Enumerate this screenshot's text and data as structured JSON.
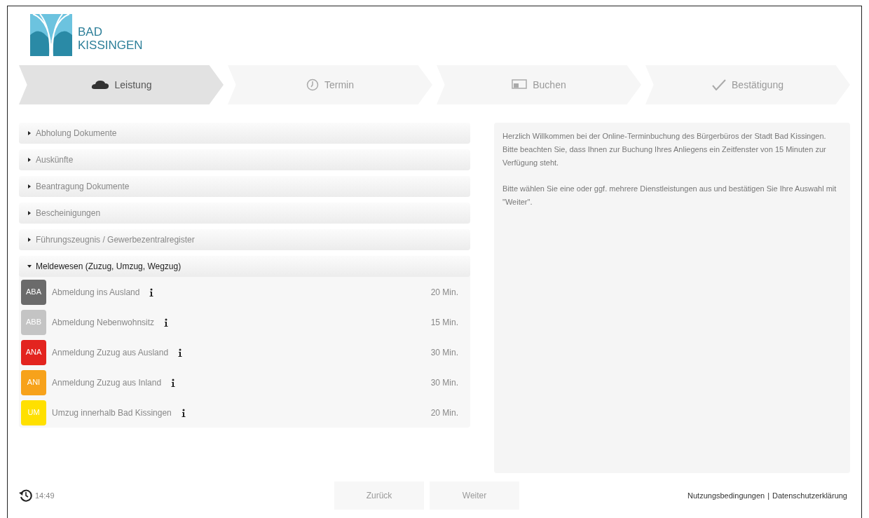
{
  "logo": {
    "line1": "BAD",
    "line2": "KISSINGEN"
  },
  "steps": [
    {
      "label": "Leistung",
      "selected": true
    },
    {
      "label": "Termin",
      "selected": false
    },
    {
      "label": "Buchen",
      "selected": false
    },
    {
      "label": "Bestätigung",
      "selected": false
    }
  ],
  "categories": [
    {
      "label": "Abholung Dokumente",
      "expanded": false
    },
    {
      "label": "Auskünfte",
      "expanded": false
    },
    {
      "label": "Beantragung Dokumente",
      "expanded": false
    },
    {
      "label": "Bescheinigungen",
      "expanded": false
    },
    {
      "label": "Führungszeugnis / Gewerbezentralregister",
      "expanded": false
    },
    {
      "label": "Meldewesen (Zuzug, Umzug, Wegzug)",
      "expanded": true,
      "services": [
        {
          "code": "ABA",
          "color": "#6b6b6b",
          "name": "Abmeldung ins Ausland",
          "duration": "20 Min."
        },
        {
          "code": "ABB",
          "color": "#c4c4c4",
          "name": "Abmeldung Nebenwohnsitz",
          "duration": "15 Min."
        },
        {
          "code": "ANA",
          "color": "#e3241f",
          "name": "Anmeldung Zuzug aus Ausland",
          "duration": "30 Min."
        },
        {
          "code": "ANI",
          "color": "#f7a21b",
          "name": "Anmeldung Zuzug aus Inland",
          "duration": "30 Min."
        },
        {
          "code": "UM",
          "color": "#ffe000",
          "name": "Umzug innerhalb Bad Kissingen",
          "duration": "20 Min."
        }
      ]
    }
  ],
  "info": [
    "Herzlich Willkommen bei der Online-Terminbuchung des Bürgerbüros der Stadt Bad Kissingen. Bitte beachten Sie, dass Ihnen zur Buchung Ihres Anliegens ein Zeitfenster von 15 Minuten zur Verfügung steht.",
    "Bitte wählen Sie eine oder ggf. mehrere Dienstleistungen aus und bestätigen Sie Ihre Auswahl mit \"Weiter\"."
  ],
  "footer": {
    "time": "14:49",
    "buttons": [
      {
        "label": "Zurück",
        "disabled": true
      },
      {
        "label": "Weiter",
        "disabled": true
      }
    ],
    "links": [
      "Nutzungsbedingungen",
      "Datenschutzerklärung"
    ],
    "separator": "|"
  }
}
